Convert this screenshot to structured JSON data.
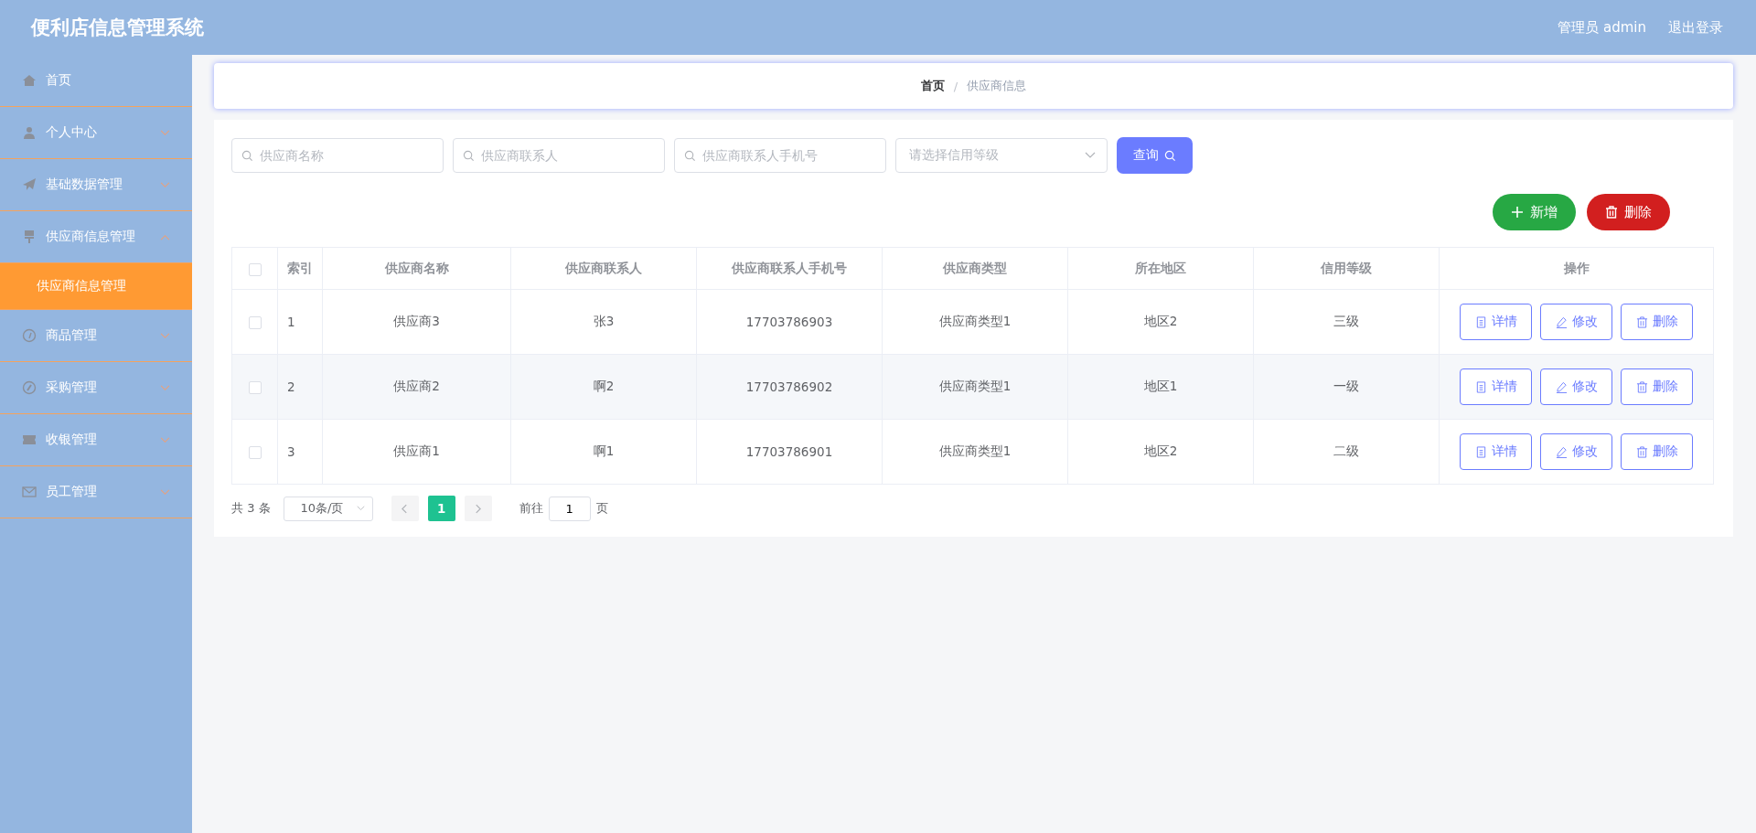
{
  "header": {
    "title": "便利店信息管理系统",
    "user": "管理员 admin",
    "logout": "退出登录"
  },
  "sidebar": {
    "items": [
      {
        "label": "首页",
        "kind": "link",
        "selected": false
      },
      {
        "label": "个人中心",
        "kind": "submenu",
        "expanded": false,
        "selected": false
      },
      {
        "label": "基础数据管理",
        "kind": "submenu",
        "expanded": false,
        "selected": false
      },
      {
        "label": "供应商信息管理",
        "kind": "submenu",
        "expanded": true,
        "selected": false,
        "children": [
          {
            "label": "供应商信息管理",
            "selected": true
          }
        ]
      },
      {
        "label": "商品管理",
        "kind": "submenu",
        "expanded": false,
        "selected": false
      },
      {
        "label": "采购管理",
        "kind": "submenu",
        "expanded": false,
        "selected": false
      },
      {
        "label": "收银管理",
        "kind": "submenu",
        "expanded": false,
        "selected": false
      },
      {
        "label": "员工管理",
        "kind": "submenu",
        "expanded": false,
        "selected": false
      }
    ]
  },
  "breadcrumb": [
    "首页",
    "供应商信息"
  ],
  "breadcrumb_separator": "/",
  "filters": {
    "name": {
      "placeholder": "供应商名称"
    },
    "contact": {
      "placeholder": "供应商联系人"
    },
    "phone": {
      "placeholder": "供应商联系人手机号"
    },
    "credit": {
      "placeholder": "请选择信用等级"
    },
    "search_button": "查询"
  },
  "actions": {
    "add": "新增",
    "delete": "删除"
  },
  "table": {
    "columns": [
      "索引",
      "供应商名称",
      "供应商联系人",
      "供应商联系人手机号",
      "供应商类型",
      "所在地区",
      "信用等级",
      "操作"
    ],
    "header_checked": false,
    "rows": [
      {
        "checked": false,
        "cells": [
          "1",
          "供应商3",
          "张3",
          "17703786903",
          "供应商类型1",
          "地区2",
          "三级"
        ],
        "buttons": [
          "详情",
          "修改",
          "删除"
        ]
      },
      {
        "checked": false,
        "cells": [
          "2",
          "供应商2",
          "啊2",
          "17703786902",
          "供应商类型1",
          "地区1",
          "一级"
        ],
        "buttons": [
          "详情",
          "修改",
          "删除"
        ]
      },
      {
        "checked": false,
        "cells": [
          "3",
          "供应商1",
          "啊1",
          "17703786901",
          "供应商类型1",
          "地区2",
          "二级"
        ],
        "buttons": [
          "详情",
          "修改",
          "删除"
        ]
      }
    ]
  },
  "pagination": {
    "total": "共 3 条",
    "page_size": "10条/页",
    "pages": [
      {
        "label": "1",
        "selected": true
      }
    ],
    "goto_label": "前往",
    "goto_value": "1",
    "goto_suffix": "页"
  }
}
